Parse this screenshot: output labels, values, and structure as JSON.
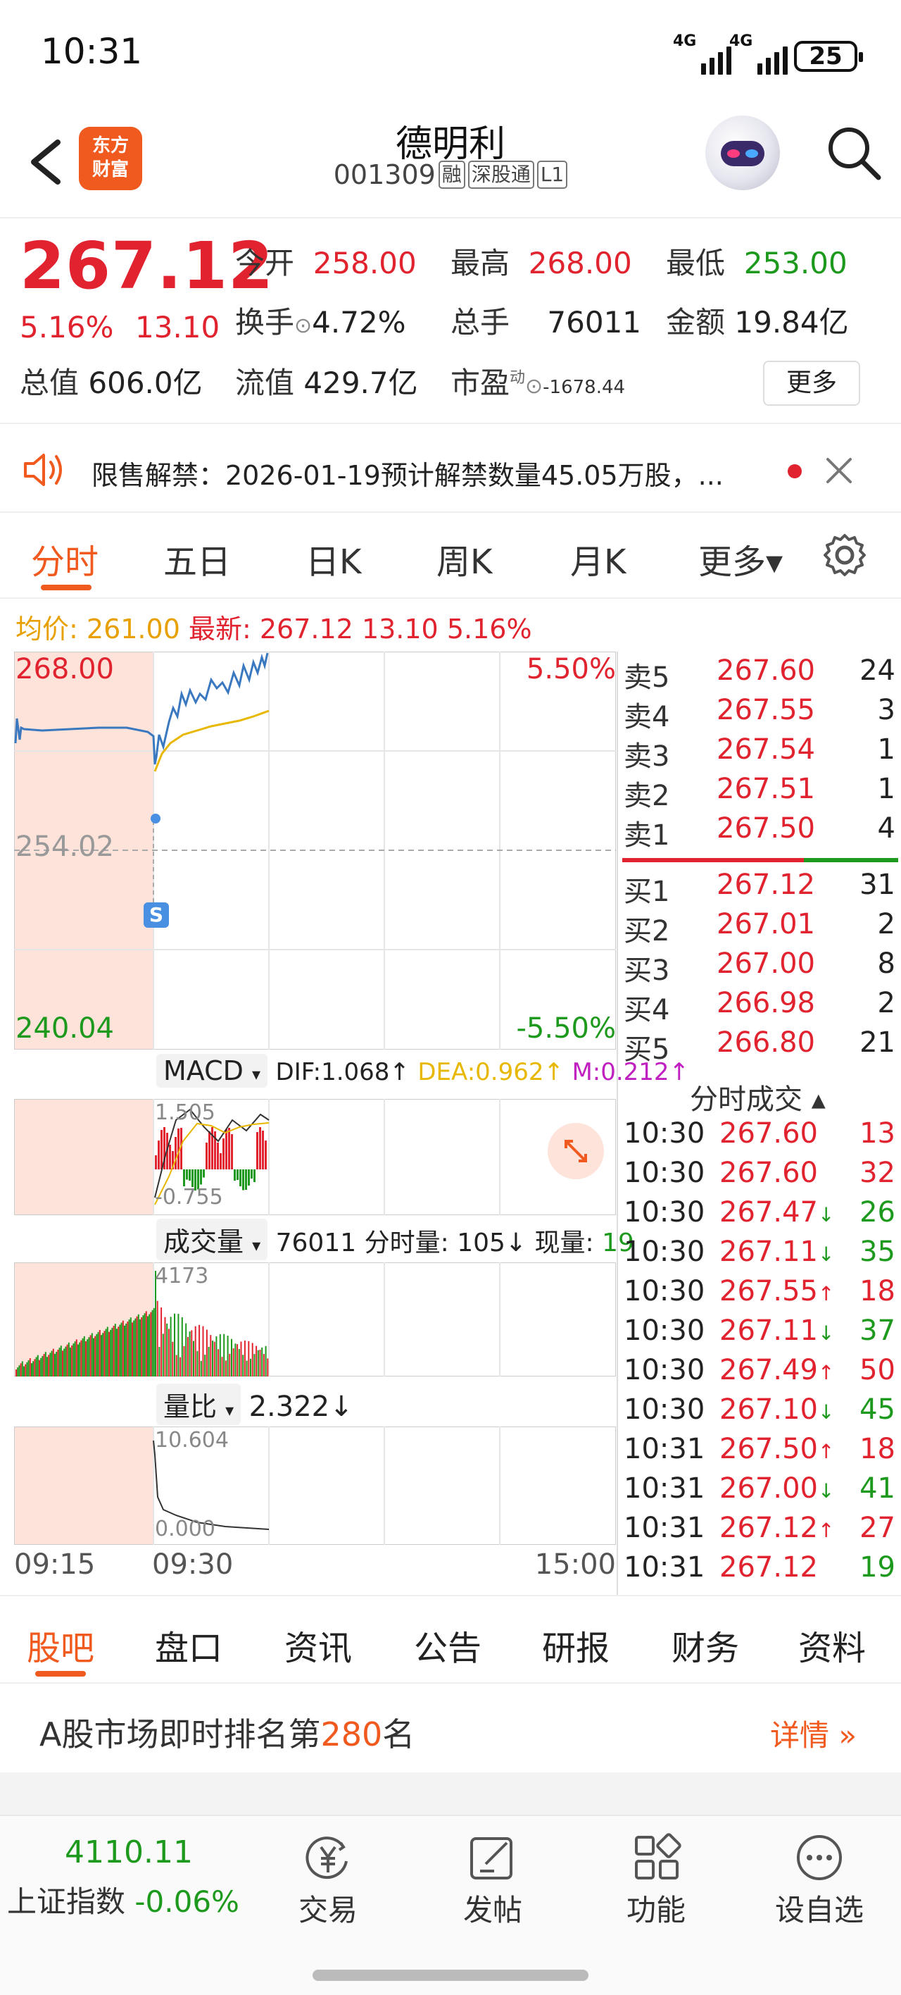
{
  "status_bar": {
    "time": "10:31",
    "sim1": "4G",
    "sim2": "4G",
    "battery": "25"
  },
  "header": {
    "logo": "东方财富",
    "name": "德明利",
    "code": "001309",
    "tags": [
      "融",
      "深股通",
      "L1"
    ]
  },
  "quote": {
    "last_price": "267.12",
    "change_pct": "5.16%",
    "change_amt": "13.10",
    "open_label": "今开",
    "open": "258.00",
    "high_label": "最高",
    "high": "268.00",
    "low_label": "最低",
    "low": "253.00",
    "turnover_label": "换手",
    "turnover": "4.72%",
    "volume_label": "总手",
    "volume": "76011",
    "amount_label": "金额",
    "amount": "19.84亿",
    "mktcap_label": "总值",
    "mktcap": "606.0亿",
    "float_label": "流值",
    "float_cap": "429.7亿",
    "pe_label": "市盈",
    "pe_sup": "动",
    "pe": "-1678.44",
    "more": "更多"
  },
  "notice": {
    "text": "限售解禁：2026-01-19预计解禁数量45.05万股，..."
  },
  "chart_tabs": [
    "分时",
    "五日",
    "日K",
    "周K",
    "月K",
    "更多▾"
  ],
  "avg_row": {
    "avg_label": "均价:",
    "avg": "261.00",
    "latest_label": "最新:",
    "latest": "267.12",
    "chg": "13.10",
    "pct": "5.16%"
  },
  "price_chart": {
    "top_price": "268.00",
    "mid_price": "254.02",
    "bottom_price": "240.04",
    "top_pct": "5.50%",
    "bottom_pct": "-5.50%",
    "marker": "S"
  },
  "macd": {
    "label": "MACD",
    "dif": "DIF:1.068↑",
    "dea": "DEA:0.962↑",
    "m": "M:0.212↑",
    "hi": "1.505",
    "lo": "-0.755"
  },
  "volume": {
    "label": "成交量",
    "total": "76011",
    "min_label": "分时量:",
    "min_vol": "105↓",
    "now_label": "现量:",
    "now_vol": "19",
    "peak": "4173"
  },
  "ratio": {
    "label": "量比",
    "value": "2.322↓",
    "hi": "10.604",
    "lo": "0.000"
  },
  "time_axis": {
    "start": "09:15",
    "open": "09:30",
    "close": "15:00"
  },
  "orderbook": {
    "asks": [
      {
        "label": "卖5",
        "price": "267.60",
        "vol": "24"
      },
      {
        "label": "卖4",
        "price": "267.55",
        "vol": "3"
      },
      {
        "label": "卖3",
        "price": "267.54",
        "vol": "1"
      },
      {
        "label": "卖2",
        "price": "267.51",
        "vol": "1"
      },
      {
        "label": "卖1",
        "price": "267.50",
        "vol": "4"
      }
    ],
    "bids": [
      {
        "label": "买1",
        "price": "267.12",
        "vol": "31"
      },
      {
        "label": "买2",
        "price": "267.01",
        "vol": "2"
      },
      {
        "label": "买3",
        "price": "267.00",
        "vol": "8"
      },
      {
        "label": "买4",
        "price": "266.98",
        "vol": "2"
      },
      {
        "label": "买5",
        "price": "266.80",
        "vol": "21"
      }
    ]
  },
  "ticks": {
    "title": "分时成交 ▴",
    "rows": [
      {
        "time": "10:30",
        "price": "267.60",
        "arrow": "",
        "vol": "13",
        "dir": "up"
      },
      {
        "time": "10:30",
        "price": "267.60",
        "arrow": "",
        "vol": "32",
        "dir": "up"
      },
      {
        "time": "10:30",
        "price": "267.47",
        "arrow": "↓",
        "vol": "26",
        "dir": "down"
      },
      {
        "time": "10:30",
        "price": "267.11",
        "arrow": "↓",
        "vol": "35",
        "dir": "down"
      },
      {
        "time": "10:30",
        "price": "267.55",
        "arrow": "↑",
        "vol": "18",
        "dir": "up"
      },
      {
        "time": "10:30",
        "price": "267.11",
        "arrow": "↓",
        "vol": "37",
        "dir": "down"
      },
      {
        "time": "10:30",
        "price": "267.49",
        "arrow": "↑",
        "vol": "50",
        "dir": "up"
      },
      {
        "time": "10:30",
        "price": "267.10",
        "arrow": "↓",
        "vol": "45",
        "dir": "down"
      },
      {
        "time": "10:31",
        "price": "267.50",
        "arrow": "↑",
        "vol": "18",
        "dir": "up"
      },
      {
        "time": "10:31",
        "price": "267.00",
        "arrow": "↓",
        "vol": "41",
        "dir": "down"
      },
      {
        "time": "10:31",
        "price": "267.12",
        "arrow": "↑",
        "vol": "27",
        "dir": "up"
      },
      {
        "time": "10:31",
        "price": "267.12",
        "arrow": "",
        "vol": "19",
        "dir": "down"
      }
    ]
  },
  "info_tabs": [
    "股吧",
    "盘口",
    "资讯",
    "公告",
    "研报",
    "财务",
    "资料"
  ],
  "rank": {
    "prefix": "A股市场即时排名第",
    "num": "280",
    "suffix": "名",
    "detail": "详情 »"
  },
  "bottom_nav": {
    "index_value": "4110.11",
    "index_name": "上证指数",
    "index_chg": "-0.06%",
    "items": [
      "交易",
      "发帖",
      "功能",
      "设自选"
    ]
  },
  "colors": {
    "up": "#e0232e",
    "down": "#1d9a1d",
    "accent": "#f05a1e",
    "avg": "#e8a000"
  }
}
